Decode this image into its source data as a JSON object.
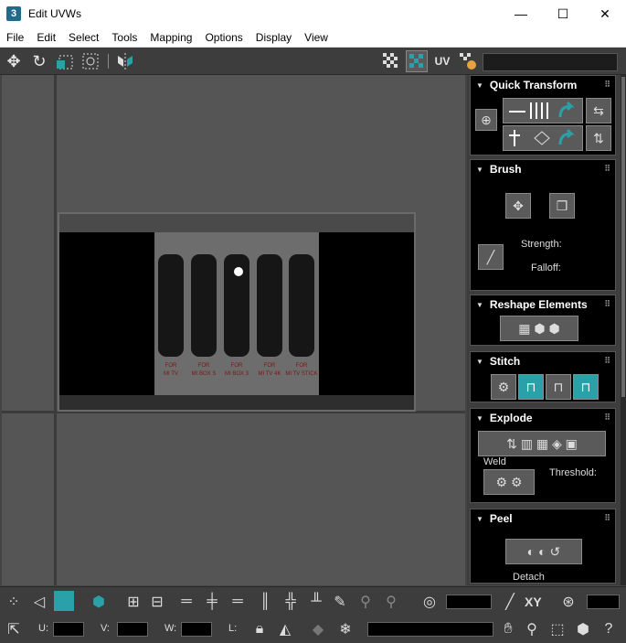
{
  "window": {
    "app_icon": "3",
    "title": "Edit UVWs",
    "minimize": "—",
    "maximize": "☐",
    "close": "✕"
  },
  "menu": [
    "File",
    "Edit",
    "Select",
    "Tools",
    "Mapping",
    "Options",
    "Display",
    "View"
  ],
  "toolbar": {
    "uv_label": "UV"
  },
  "viewport": {
    "remote_labels": [
      "FOR\nMI TV",
      "FOR\nMI BOX S",
      "FOR\nMI BOX 3",
      "FOR\nMI TV 4K",
      "FOR\nMI TV STICK"
    ]
  },
  "panel": {
    "quick_transform": {
      "title": "Quick Transform"
    },
    "brush": {
      "title": "Brush",
      "strength_label": "Strength:",
      "falloff_label": "Falloff:"
    },
    "reshape": {
      "title": "Reshape Elements"
    },
    "stitch": {
      "title": "Stitch"
    },
    "explode": {
      "title": "Explode",
      "weld_label": "Weld",
      "threshold_label": "Threshold:"
    },
    "peel": {
      "title": "Peel",
      "detach_label": "Detach"
    }
  },
  "bottom": {
    "xy_label": "XY",
    "u_label": "U:",
    "v_label": "V:",
    "w_label": "W:",
    "l_label": "L:"
  },
  "colors": {
    "accent_teal": "#2aa0a8",
    "panel_bg": "#000000",
    "ui_gray": "#3d3d3d"
  }
}
